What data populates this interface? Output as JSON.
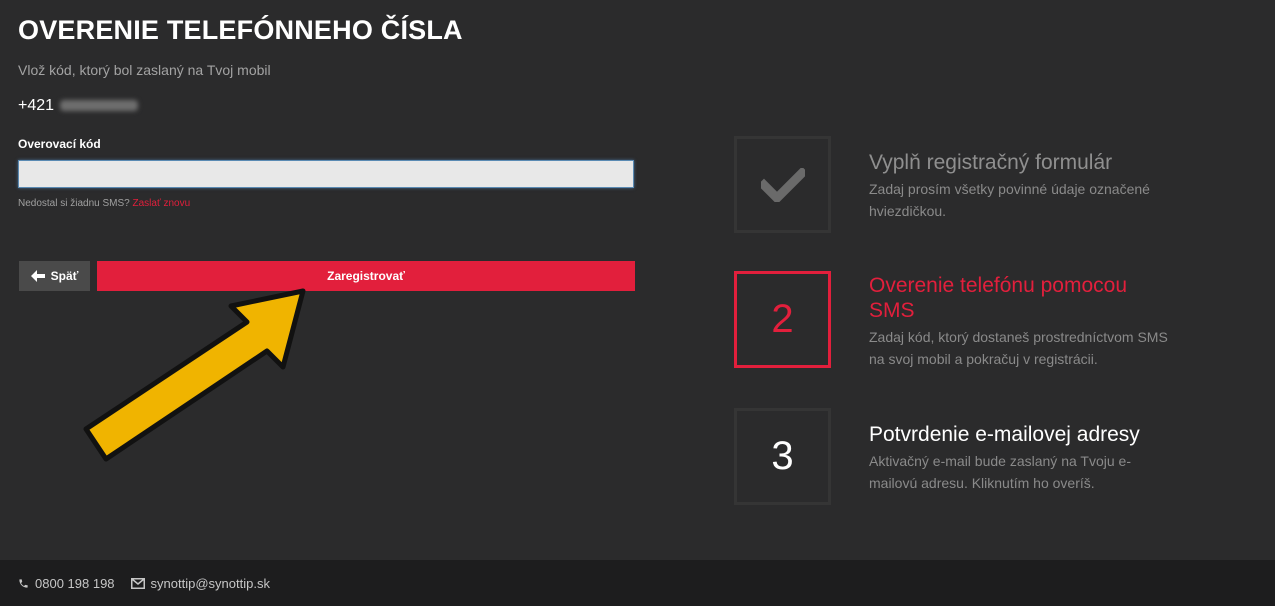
{
  "page": {
    "title": "OVERENIE TELEFÓNNEHO ČÍSLA",
    "subtitle": "Vlož kód, ktorý bol zaslaný na Tvoj mobil",
    "phone_prefix": "+421"
  },
  "form": {
    "code_label": "Overovací kód",
    "code_value": "",
    "resend_text": "Nedostal si žiadnu SMS?",
    "resend_link": "Zaslať znovu",
    "back_label": "Späť",
    "register_label": "Zaregistrovať"
  },
  "steps": [
    {
      "number": "",
      "icon": "check-icon",
      "title": "Vyplň registračný formulár",
      "desc": "Zadaj prosím všetky povinné údaje označené hviezdičkou.",
      "state": "done"
    },
    {
      "number": "2",
      "title": "Overenie telefónu pomocou SMS",
      "desc": "Zadaj kód, ktorý dostaneš prostredníctvom SMS na svoj mobil a pokračuj v registrácii.",
      "state": "active"
    },
    {
      "number": "3",
      "title": "Potvrdenie e-mailovej adresy",
      "desc": "Aktivačný e-mail bude zaslaný na Tvoju e-mailovú adresu. Kliknutím ho overíš.",
      "state": "upcoming"
    }
  ],
  "footer": {
    "phone": "0800 198 198",
    "email": "synottip@synottip.sk"
  },
  "colors": {
    "accent": "#e21f3c",
    "background": "#2b2b2c",
    "footer": "#1d1d1e",
    "arrow": "#f0b400"
  }
}
